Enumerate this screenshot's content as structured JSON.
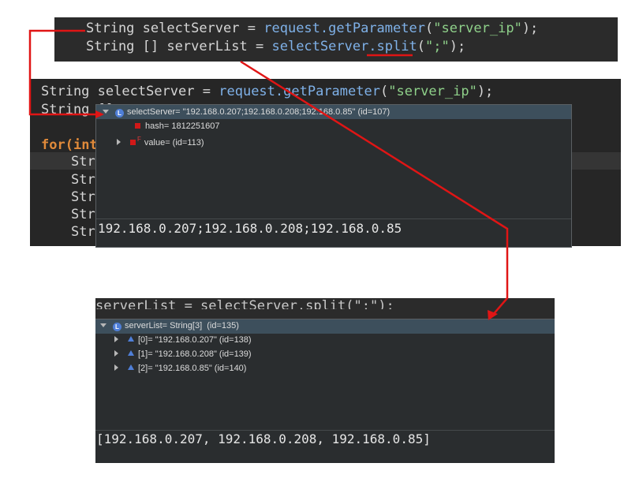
{
  "top_snippet": {
    "line1": {
      "type": "String",
      "var": "selectServer",
      "eq": "=",
      "obj": "request.",
      "method": "getParameter",
      "open": "(",
      "arg": "\"server_ip\"",
      "close": ");"
    },
    "line2": {
      "type": "String []",
      "var": "serverList",
      "eq": "=",
      "obj": "selectServer.",
      "method": "split",
      "open": "(",
      "arg": "\";\"",
      "close": ");"
    }
  },
  "editor": {
    "line1": {
      "type": "String",
      "var": "selectServer",
      "eq": "=",
      "obj": "request.",
      "method": "getParameter",
      "open": "(",
      "arg": "\"server_ip\"",
      "close": ");"
    },
    "line2_prefix": "String [] ",
    "for_kw": "for",
    "for_rest": "(int",
    "truncated_lines": [
      "Str",
      "Str",
      "Str",
      "Str",
      "Str"
    ]
  },
  "tooltip1": {
    "header": "selectServer= \"192.168.0.207;192.168.0.208;192.168.0.85\" (id=107)",
    "rows": [
      {
        "label": "hash= 1812251607"
      },
      {
        "label": "value= (id=113)"
      }
    ],
    "detail": "192.168.0.207;192.168.0.208;192.168.0.85",
    "badge": "L",
    "final_marker": "F"
  },
  "tooltip2": {
    "partial_code": "serverList = selectServer.split(\";\");",
    "header": "serverList= String[3]  (id=135)",
    "rows": [
      {
        "label": "[0]= \"192.168.0.207\" (id=138)"
      },
      {
        "label": "[1]= \"192.168.0.208\" (id=139)"
      },
      {
        "label": "[2]= \"192.168.0.85\" (id=140)"
      }
    ],
    "detail": "[192.168.0.207, 192.168.0.208, 192.168.0.85]",
    "badge": "L"
  },
  "colors": {
    "annotation_red": "#e01515",
    "string_green": "#8fd18a",
    "method_blue": "#7fb1e8",
    "keyword_orange": "#e08a3a"
  }
}
